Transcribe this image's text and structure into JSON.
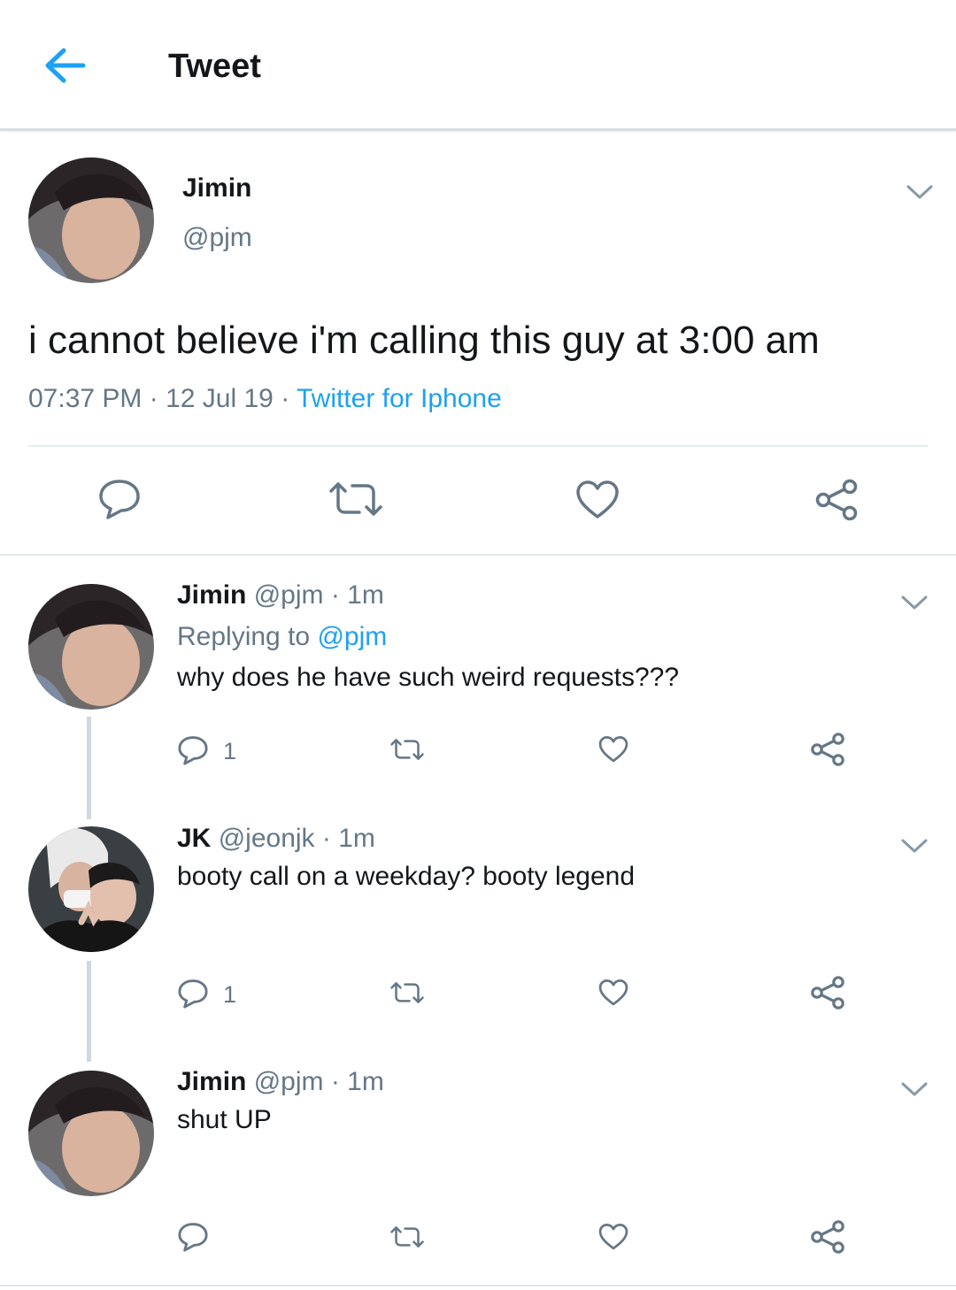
{
  "header": {
    "title": "Tweet"
  },
  "main_tweet": {
    "name": "Jimin",
    "handle": "@pjm",
    "text": "i cannot believe i'm calling this guy at 3:00 am",
    "time": "07:37 PM",
    "sep1": " · ",
    "date": "12 Jul 19",
    "sep2": " · ",
    "source": "Twitter for Iphone"
  },
  "replies": [
    {
      "name": "Jimin",
      "handle": "@pjm",
      "age": "1m",
      "sep": " · ",
      "replying_prefix": "Replying to ",
      "replying_handle": "@pjm",
      "text": "why does he have such weird requests???",
      "reply_count": "1"
    },
    {
      "name": "JK",
      "handle": "@jeonjk",
      "age": "1m",
      "sep": " · ",
      "text": "booty call on a weekday? booty legend",
      "reply_count": "1"
    },
    {
      "name": "Jimin",
      "handle": "@pjm",
      "age": "1m",
      "sep": " · ",
      "text": "shut UP",
      "reply_count": ""
    }
  ],
  "colors": {
    "accent": "#1da1f2",
    "secondary_text": "#657786",
    "icon": "#657786"
  }
}
